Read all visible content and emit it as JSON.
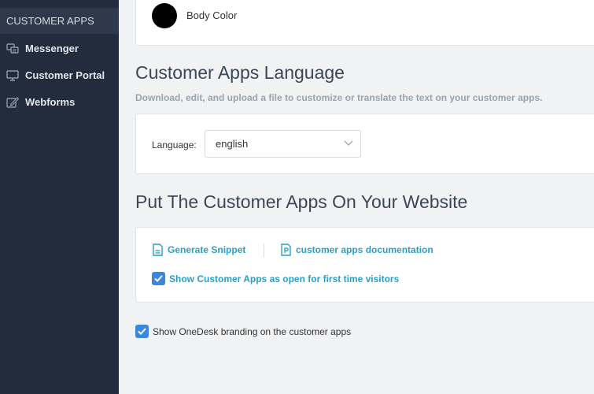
{
  "sidebar": {
    "header": "CUSTOMER APPS",
    "items": [
      {
        "label": "Messenger",
        "icon": "messenger-icon"
      },
      {
        "label": "Customer Portal",
        "icon": "monitor-icon"
      },
      {
        "label": "Webforms",
        "icon": "edit-form-icon"
      }
    ]
  },
  "colors": {
    "sidebar_bg": "#222c3c",
    "accent_link": "#2a9fc3",
    "checkbox": "#3b86de",
    "body_color_swatch": "#000000"
  },
  "body_color": {
    "label": "Body Color"
  },
  "language_section": {
    "title": "Customer Apps Language",
    "description": "Download, edit, and upload a file to customize or translate the text on your customer apps.",
    "label": "Language:",
    "selected": "english"
  },
  "website_section": {
    "title": "Put The Customer Apps On Your Website",
    "generate_snippet": "Generate Snippet",
    "documentation": "customer apps documentation",
    "show_open_label": "Show Customer Apps as open for first time visitors",
    "show_open_checked": true
  },
  "branding": {
    "label": "Show OneDesk branding on the customer apps",
    "checked": true
  }
}
